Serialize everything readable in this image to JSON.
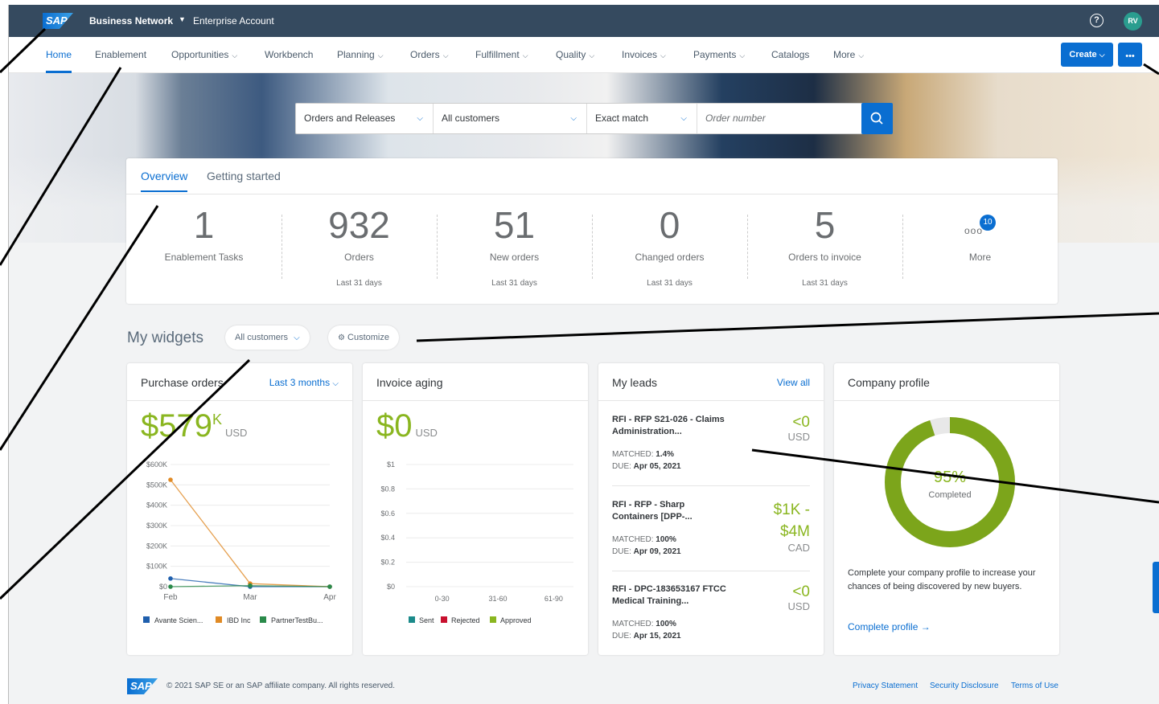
{
  "shell": {
    "business_network": "Business Network",
    "account": "Enterprise Account",
    "help": "?",
    "avatar": "RV",
    "logo": "SAP"
  },
  "nav": {
    "items": [
      "Home",
      "Enablement",
      "Opportunities",
      "Workbench",
      "Planning",
      "Orders",
      "Fulfillment",
      "Quality",
      "Invoices",
      "Payments",
      "Catalogs",
      "More"
    ],
    "create": "Create",
    "more_dots": "•••"
  },
  "search": {
    "type": "Orders and Releases",
    "customers": "All customers",
    "match": "Exact match",
    "placeholder": "Order number"
  },
  "overview": {
    "tabs": [
      "Overview",
      "Getting started"
    ],
    "tiles": [
      {
        "value": "1",
        "label": "Enablement Tasks",
        "sub": ""
      },
      {
        "value": "932",
        "label": "Orders",
        "sub": "Last 31 days"
      },
      {
        "value": "51",
        "label": "New orders",
        "sub": "Last 31 days"
      },
      {
        "value": "0",
        "label": "Changed orders",
        "sub": "Last 31 days"
      },
      {
        "value": "5",
        "label": "Orders to invoice",
        "sub": "Last 31 days"
      }
    ],
    "more_label": "More",
    "more_badge": "10",
    "more_dots": "ooo"
  },
  "widgets": {
    "title": "My widgets",
    "filter": "All customers",
    "customize": "Customize"
  },
  "purchase_orders": {
    "title": "Purchase orders",
    "range": "Last 3 months",
    "value": "$579",
    "unit": "K",
    "currency": "USD"
  },
  "invoice_aging": {
    "title": "Invoice aging",
    "value": "$0",
    "currency": "USD"
  },
  "my_leads": {
    "title": "My leads",
    "view_all": "View all",
    "leads": [
      {
        "title": "RFI - RFP S21-026 - Claims Administration...",
        "amount": "<0",
        "currency": "USD",
        "matched": "1.4%",
        "due": "Apr 05, 2021"
      },
      {
        "title": "RFI - RFP - Sharp Containers [DPP-...",
        "amount": "$1K - $4M",
        "currency": "CAD",
        "matched": "100%",
        "due": "Apr 09, 2021"
      },
      {
        "title": "RFI - DPC-183653167 FTCC Medical Training...",
        "amount": "<0",
        "currency": "USD",
        "matched": "100%",
        "due": "Apr 15, 2021"
      }
    ],
    "matched_label": "MATCHED: ",
    "due_label": "DUE: "
  },
  "company_profile": {
    "title": "Company profile",
    "percent": "95%",
    "percent_value": 95,
    "completed": "Completed",
    "text": "Complete your company profile to increase your chances of being discovered by new buyers.",
    "link": "Complete profile →"
  },
  "footer": {
    "copyright": "© 2021 SAP SE or an SAP affiliate company. All rights reserved.",
    "links": [
      "Privacy Statement",
      "Security Disclosure",
      "Terms of Use"
    ]
  },
  "chart_data": [
    {
      "type": "line",
      "categories": [
        "Feb",
        "Mar",
        "Apr"
      ],
      "ylim": [
        0,
        600
      ],
      "yticks": [
        "$0",
        "$100K",
        "$200K",
        "$300K",
        "$400K",
        "$500K",
        "$600K"
      ],
      "series": [
        {
          "name": "Avante Scien...",
          "color": "#1f5fad",
          "values": [
            40,
            0,
            0
          ]
        },
        {
          "name": "IBD Inc",
          "color": "#e08a25",
          "values": [
            525,
            15,
            0
          ]
        },
        {
          "name": "PartnerTestBu...",
          "color": "#2a8a4a",
          "values": [
            0,
            5,
            0
          ]
        }
      ]
    },
    {
      "type": "bar",
      "categories": [
        "0-30",
        "31-60",
        "61-90"
      ],
      "ylim": [
        0,
        1
      ],
      "yticks": [
        "$0",
        "$0.2",
        "$0.4",
        "$0.6",
        "$0.8",
        "$1"
      ],
      "series": [
        {
          "name": "Sent",
          "color": "#1b8a8a",
          "values": [
            0,
            0,
            0
          ]
        },
        {
          "name": "Rejected",
          "color": "#c8102e",
          "values": [
            0,
            0,
            0
          ]
        },
        {
          "name": "Approved",
          "color": "#8ab620",
          "values": [
            0,
            0,
            0
          ]
        }
      ]
    }
  ]
}
